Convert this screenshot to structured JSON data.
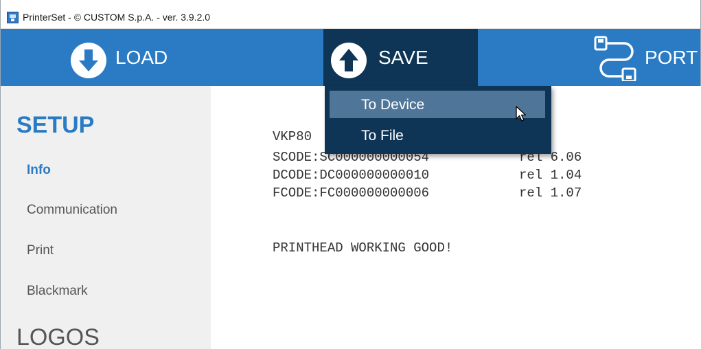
{
  "window": {
    "title": "PrinterSet - © CUSTOM S.p.A. - ver. 3.9.2.0"
  },
  "toolbar": {
    "load_label": "LOAD",
    "save_label": "SAVE",
    "port_label": "PORT"
  },
  "save_menu": {
    "items": [
      {
        "label": "To Device"
      },
      {
        "label": "To File"
      }
    ]
  },
  "sidebar": {
    "heading": "SETUP",
    "items": [
      {
        "label": "Info"
      },
      {
        "label": "Communication"
      },
      {
        "label": "Print"
      },
      {
        "label": "Blackmark"
      }
    ],
    "heading2": "LOGOS"
  },
  "info": {
    "model": "VKP80",
    "scode": "SCODE:SC000000000054",
    "scode_rel": "rel 6.06",
    "dcode": "DCODE:DC000000000010",
    "dcode_rel": "rel 1.04",
    "fcode": "FCODE:FC000000000006",
    "fcode_rel": "rel 1.07",
    "status": "PRINTHEAD WORKING GOOD!"
  },
  "colors": {
    "toolbar": "#2a7bc4",
    "save_active": "#0e3556",
    "menu_hover": "#4f7699",
    "accent_text": "#2a7bc4"
  }
}
